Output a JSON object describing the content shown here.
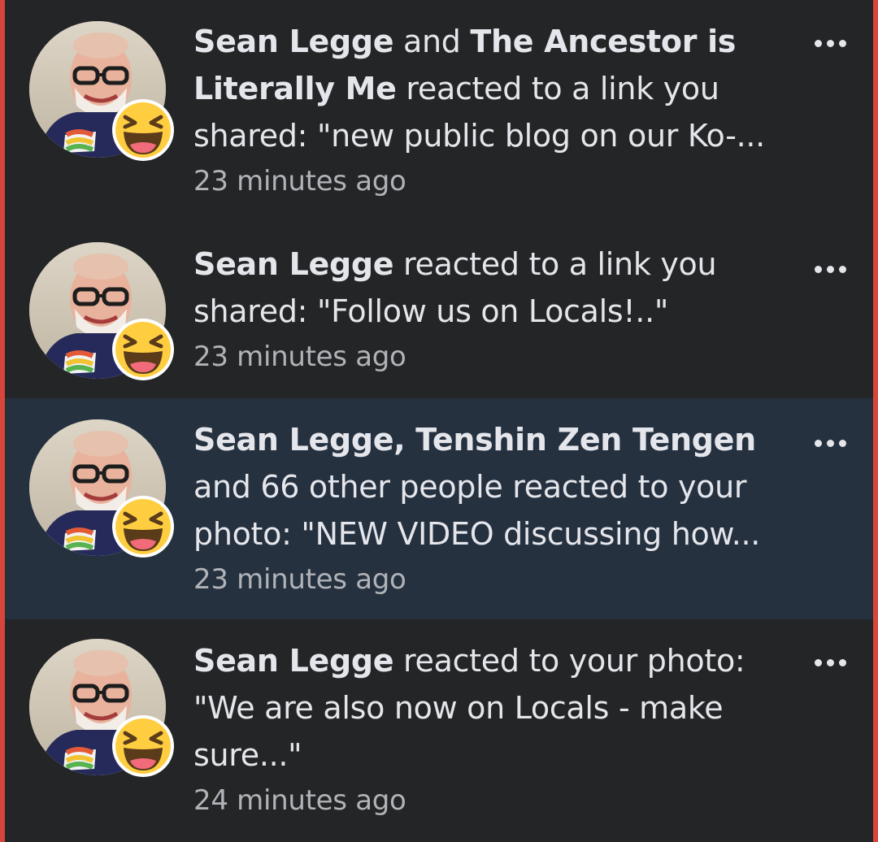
{
  "notifications": [
    {
      "actor1": "Sean Legge",
      "connector": " and ",
      "actor2": "The Ancestor is Literally Me",
      "action": "  reacted to a link you shared: \"new public blog on our Ko-...",
      "time": "23 minutes ago",
      "reaction": "laughing-emoji",
      "unread": false
    },
    {
      "actor1": "Sean Legge",
      "connector": "",
      "actor2": "",
      "action": " reacted to a link you shared: \"Follow us on Locals!..\"",
      "time": "23 minutes ago",
      "reaction": "laughing-emoji",
      "unread": false
    },
    {
      "actor1": "Sean Legge, Tenshin Zen Tengen",
      "connector": "",
      "actor2": "",
      "action": " and 66 other people reacted to your photo: \"NEW VIDEO discussing how...",
      "time": "23 minutes ago",
      "reaction": "laughing-emoji",
      "unread": true
    },
    {
      "actor1": "Sean Legge",
      "connector": "",
      "actor2": "",
      "action": " reacted to your photo: \"We are also now on Locals - make sure...\"",
      "time": "24 minutes ago",
      "reaction": "laughing-emoji",
      "unread": false
    }
  ],
  "colors": {
    "background": "#242526",
    "unread_background": "#263140",
    "text": "#e4e6eb",
    "secondary_text": "#b0b3b8",
    "edge": "#d9453b",
    "emoji": "#ffcd40"
  },
  "icons": {
    "more": "more-horizontal-icon",
    "avatar": "avatar",
    "reaction": "laughing-emoji-icon"
  }
}
